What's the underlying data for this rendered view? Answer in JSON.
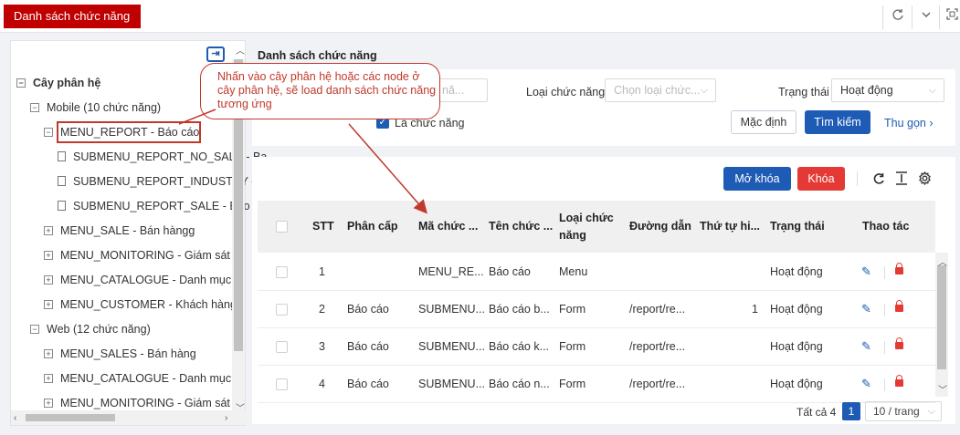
{
  "header": {
    "title": "Danh sách chức năng",
    "icons": [
      "refresh-icon",
      "chevron-down-icon",
      "fullscreen-icon"
    ]
  },
  "tree": {
    "root": "Cây phân hệ",
    "nodes": [
      {
        "label": "Mobile (10 chức năng)",
        "state": "expanded"
      },
      {
        "label": "MENU_REPORT - Báo cáo",
        "state": "expanded",
        "selected": true
      },
      {
        "label": "SUBMENU_REPORT_NO_SALE - Ba",
        "state": "leaf"
      },
      {
        "label": "SUBMENU_REPORT_INDUSTRY - E",
        "state": "leaf"
      },
      {
        "label": "SUBMENU_REPORT_SALE - Báo cá",
        "state": "leaf"
      },
      {
        "label": "MENU_SALE - Bán hàngg",
        "state": "collapsed"
      },
      {
        "label": "MENU_MONITORING - Giám sát",
        "state": "collapsed"
      },
      {
        "label": "MENU_CATALOGUE - Danh mục",
        "state": "collapsed"
      },
      {
        "label": "MENU_CUSTOMER - Khách hàng",
        "state": "collapsed"
      },
      {
        "label": "Web (12 chức năng)",
        "state": "expanded"
      },
      {
        "label": "MENU_SALES - Bán hàng",
        "state": "collapsed"
      },
      {
        "label": "MENU_CATALOGUE - Danh mục",
        "state": "collapsed"
      },
      {
        "label": "MENU_MONITORING - Giám sát",
        "state": "collapsed"
      }
    ]
  },
  "main": {
    "title": "Danh sách chức năng",
    "filters": {
      "search_placeholder": "nă...",
      "type_label": "Loại chức năng",
      "type_placeholder": "Chọn loại chức...",
      "status_label": "Trạng thái",
      "status_value": "Hoạt động",
      "checkbox_label": "Là chức năng",
      "default_button": "Mặc định",
      "search_button": "Tìm kiếm",
      "collapse_link": "Thu gọn"
    },
    "toolbar": {
      "unlock_button": "Mở khóa",
      "lock_button": "Khóa"
    },
    "table": {
      "columns": [
        "STT",
        "Phân cấp",
        "Mã chức ...",
        "Tên chức ...",
        "Loại chức năng",
        "Đường dẫn",
        "Thứ tự hi...",
        "Trạng thái",
        "Thao tác"
      ],
      "rows": [
        {
          "stt": "1",
          "level": "",
          "code": "MENU_RE...",
          "name": "Báo cáo",
          "type": "Menu",
          "path": "",
          "order": "",
          "status": "Hoạt động"
        },
        {
          "stt": "2",
          "level": "Báo cáo",
          "code": "SUBMENU...",
          "name": "Báo cáo b...",
          "type": "Form",
          "path": "/report/re...",
          "order": "1",
          "status": "Hoạt động"
        },
        {
          "stt": "3",
          "level": "Báo cáo",
          "code": "SUBMENU...",
          "name": "Báo cáo k...",
          "type": "Form",
          "path": "/report/re...",
          "order": "",
          "status": "Hoạt động"
        },
        {
          "stt": "4",
          "level": "Báo cáo",
          "code": "SUBMENU...",
          "name": "Báo cáo n...",
          "type": "Form",
          "path": "/report/re...",
          "order": "",
          "status": "Hoạt động"
        }
      ]
    },
    "pagination": {
      "total": "Tất cả 4",
      "current_page": "1",
      "page_size": "10 / trang"
    }
  },
  "annotation": {
    "text": "Nhấn vào cây phân hệ hoặc các node ở cây phân hệ, sẽ load danh sách chức năng tương ứng"
  },
  "colors": {
    "brand_red": "#c00000",
    "primary_blue": "#1e5bb4",
    "danger_red": "#e53935"
  }
}
